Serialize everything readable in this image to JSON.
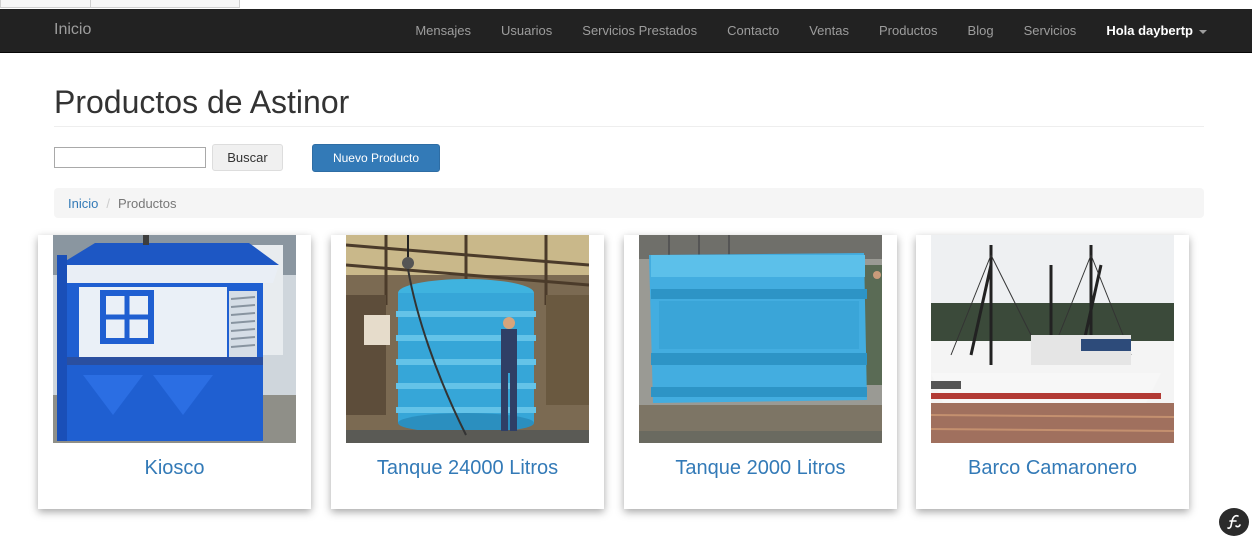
{
  "navbar": {
    "brand": "Inicio",
    "items": [
      "Mensajes",
      "Usuarios",
      "Servicios Prestados",
      "Contacto",
      "Ventas",
      "Productos",
      "Blog",
      "Servicios"
    ],
    "user": "Hola daybertp"
  },
  "page": {
    "title": "Productos de Astinor"
  },
  "search": {
    "value": "",
    "button": "Buscar"
  },
  "new_product_button": "Nuevo Producto",
  "breadcrumb": {
    "home": "Inicio",
    "separator": "/",
    "current": "Productos"
  },
  "products": [
    {
      "name": "Kiosco"
    },
    {
      "name": "Tanque 24000 Litros"
    },
    {
      "name": "Tanque 2000 Litros"
    },
    {
      "name": "Barco Camaronero"
    }
  ],
  "colors": {
    "navbar": "#222222",
    "nav_text": "#9d9d9d",
    "link": "#337ab7",
    "primary_button": "#337ab7"
  },
  "icons": {
    "dropdown": "caret-down-icon",
    "debug_toolbar": "symfony-icon"
  }
}
